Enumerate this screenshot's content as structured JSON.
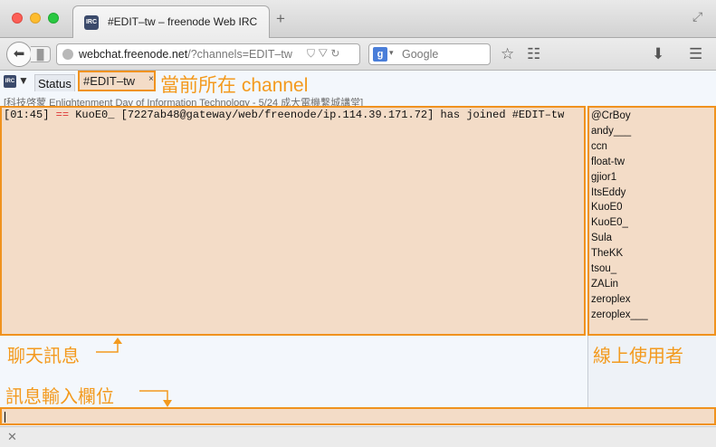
{
  "window": {
    "tab_title": "#EDIT–tw – freenode Web IRC",
    "new_tab": "+"
  },
  "nav": {
    "back_glyph": "⬅",
    "url_host": "webchat.freenode.net",
    "url_path": "/?channels=EDIT–tw",
    "search_placeholder": "Google",
    "icons": [
      "star-icon",
      "reading-list-icon",
      "download-icon",
      "menu-icon"
    ]
  },
  "irc": {
    "status_tab": "Status",
    "channel_tab": "#EDIT–tw",
    "channel_close": "×",
    "topic": "[科技啓蒙 Enlightenment Day of Information Technology -  5/24 成大電機繫城講堂]",
    "message": {
      "time": "[01:45]",
      "arrow": "==",
      "nick": "KuoE0_",
      "text": "[7227ab48@gateway/web/freenode/ip.114.39.171.72] has joined #EDIT–tw"
    },
    "nicks": [
      "@CrBoy",
      "andy___",
      "ccn",
      "float-tw",
      "gjior1",
      "ItsEddy",
      "KuoE0",
      "KuoE0_",
      "Sula",
      "TheKK",
      "tsou_",
      "ZALin",
      "zeroplex",
      "zeroplex___"
    ]
  },
  "annotations": {
    "current_channel": "當前所在 channel",
    "chat_messages": "聊天訊息",
    "online_users": "線上使用者",
    "input_field": "訊息輸入欄位"
  },
  "colors": {
    "highlight": "#f0921e",
    "fill": "#f3dcc7"
  }
}
